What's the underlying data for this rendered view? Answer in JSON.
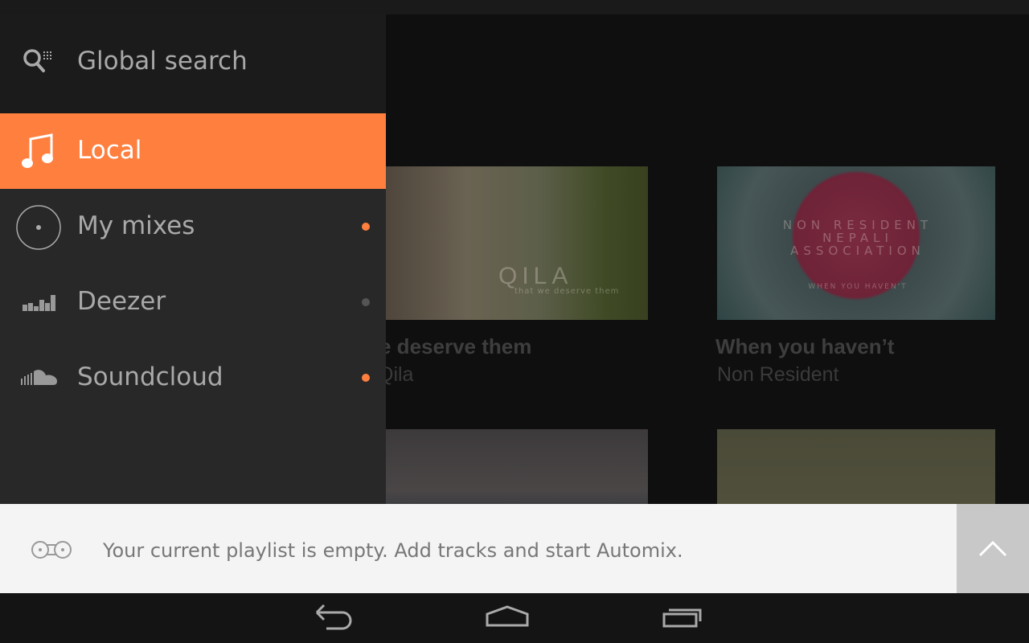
{
  "drawer": {
    "search_label": "Global search",
    "items": [
      {
        "label": "Local",
        "icon": "music-note-icon",
        "active": true
      },
      {
        "label": "My mixes",
        "icon": "vinyl-icon",
        "badge_color": "#ff7f3f"
      },
      {
        "label": "Deezer",
        "icon": "deezer-icon",
        "badge_color": "#555555"
      },
      {
        "label": "Soundcloud",
        "icon": "soundcloud-icon",
        "badge_color": "#ff7f3f"
      }
    ]
  },
  "albums": [
    {
      "title": "e deserve them",
      "artist": "Qila",
      "art_text": "QILA",
      "art_subtext": "that we deserve them"
    },
    {
      "title": "When you haven’t",
      "artist": "Non Resident",
      "art_text": "NON RESIDENT NEPALI ASSOCIATION",
      "art_subtext": "WHEN YOU HAVEN'T"
    },
    {},
    {}
  ],
  "player": {
    "message": "Your current playlist is empty. Add tracks and start Automix."
  },
  "colors": {
    "accent": "#ff7f3f"
  }
}
